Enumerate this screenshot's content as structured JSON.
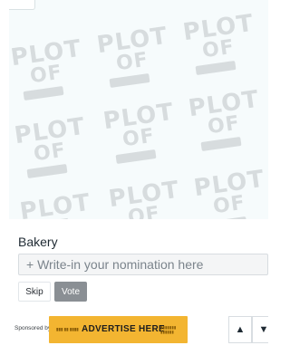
{
  "image_panel": {
    "watermark_title": "PLOT",
    "watermark_subtitle": "OF"
  },
  "nomination": {
    "category": "Bakery",
    "write_in_placeholder": "+ Write-in your nomination here",
    "skip_label": "Skip",
    "vote_label": "Vote"
  },
  "sponsor": {
    "label": "Sponsored by:",
    "ad_text": "ADVERTISE HERE"
  },
  "nav": {
    "up_icon": "▲",
    "down_icon": "▼"
  },
  "colors": {
    "ad_background": "#f3b531",
    "vote_button": "#8a8f94"
  }
}
